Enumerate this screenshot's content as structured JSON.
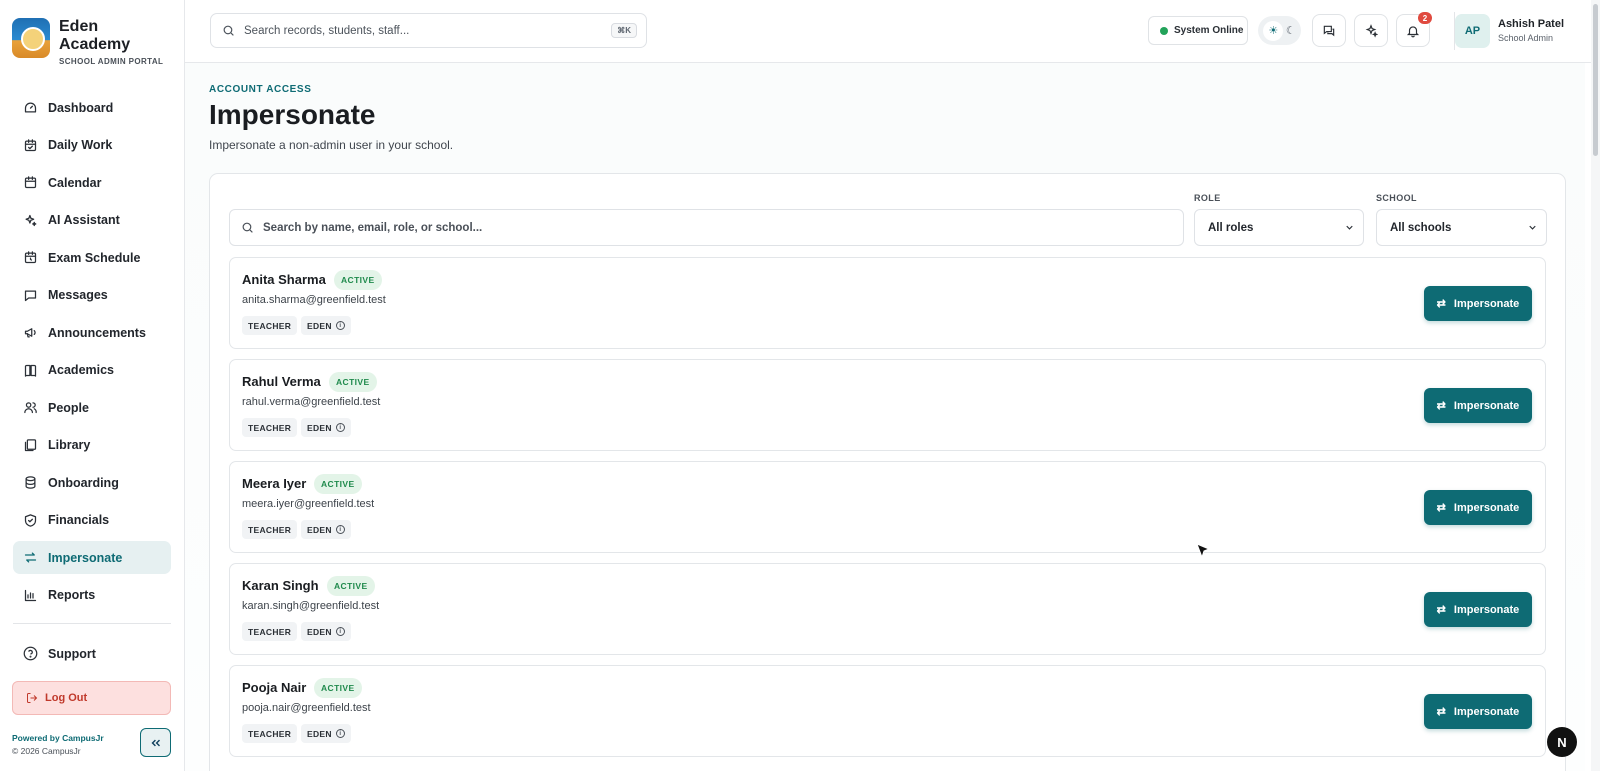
{
  "brand": {
    "name": "Eden Academy",
    "subtitle": "SCHOOL ADMIN PORTAL"
  },
  "sidebar": {
    "items": [
      {
        "label": "Dashboard",
        "icon": "dashboard-icon"
      },
      {
        "label": "Daily Work",
        "icon": "calendar-check-icon"
      },
      {
        "label": "Calendar",
        "icon": "calendar-icon"
      },
      {
        "label": "AI Assistant",
        "icon": "sparkles-icon"
      },
      {
        "label": "Exam Schedule",
        "icon": "calendar-clock-icon"
      },
      {
        "label": "Messages",
        "icon": "message-icon"
      },
      {
        "label": "Announcements",
        "icon": "megaphone-icon"
      },
      {
        "label": "Academics",
        "icon": "book-icon"
      },
      {
        "label": "People",
        "icon": "users-icon"
      },
      {
        "label": "Library",
        "icon": "library-icon"
      },
      {
        "label": "Onboarding",
        "icon": "database-icon"
      },
      {
        "label": "Financials",
        "icon": "shield-icon"
      },
      {
        "label": "Impersonate",
        "icon": "swap-icon",
        "active": true
      },
      {
        "label": "Reports",
        "icon": "bar-chart-icon"
      }
    ],
    "support_label": "Support",
    "logout_label": "Log Out",
    "powered_by": "Powered by CampusJr",
    "copyright": "© 2026 CampusJr"
  },
  "header": {
    "search_placeholder": "Search records, students, staff...",
    "shortcut": "⌘K",
    "status_label": "System Online",
    "notification_count": "2",
    "user": {
      "initials": "AP",
      "name": "Ashish Patel",
      "role": "School Admin"
    }
  },
  "page": {
    "eyebrow": "ACCOUNT ACCESS",
    "title": "Impersonate",
    "subtitle": "Impersonate a non-admin user in your school."
  },
  "filters": {
    "search_placeholder": "Search by name, email, role, or school...",
    "role_label": "ROLE",
    "role_value": "All roles",
    "school_label": "SCHOOL",
    "school_value": "All schools"
  },
  "users": [
    {
      "name": "Anita Sharma",
      "status": "ACTIVE",
      "email": "anita.sharma@greenfield.test",
      "role": "TEACHER",
      "school": "EDEN"
    },
    {
      "name": "Rahul Verma",
      "status": "ACTIVE",
      "email": "rahul.verma@greenfield.test",
      "role": "TEACHER",
      "school": "EDEN"
    },
    {
      "name": "Meera Iyer",
      "status": "ACTIVE",
      "email": "meera.iyer@greenfield.test",
      "role": "TEACHER",
      "school": "EDEN"
    },
    {
      "name": "Karan Singh",
      "status": "ACTIVE",
      "email": "karan.singh@greenfield.test",
      "role": "TEACHER",
      "school": "EDEN"
    },
    {
      "name": "Pooja Nair",
      "status": "ACTIVE",
      "email": "pooja.nair@greenfield.test",
      "role": "TEACHER",
      "school": "EDEN"
    }
  ],
  "action_label": "Impersonate",
  "fab_label": "N",
  "colors": {
    "accent": "#0e6b74",
    "active_badge_bg": "#e3f4e8",
    "active_badge_text": "#1f8a4c",
    "logout_bg": "#fde0df",
    "notification": "#e04a3f"
  }
}
